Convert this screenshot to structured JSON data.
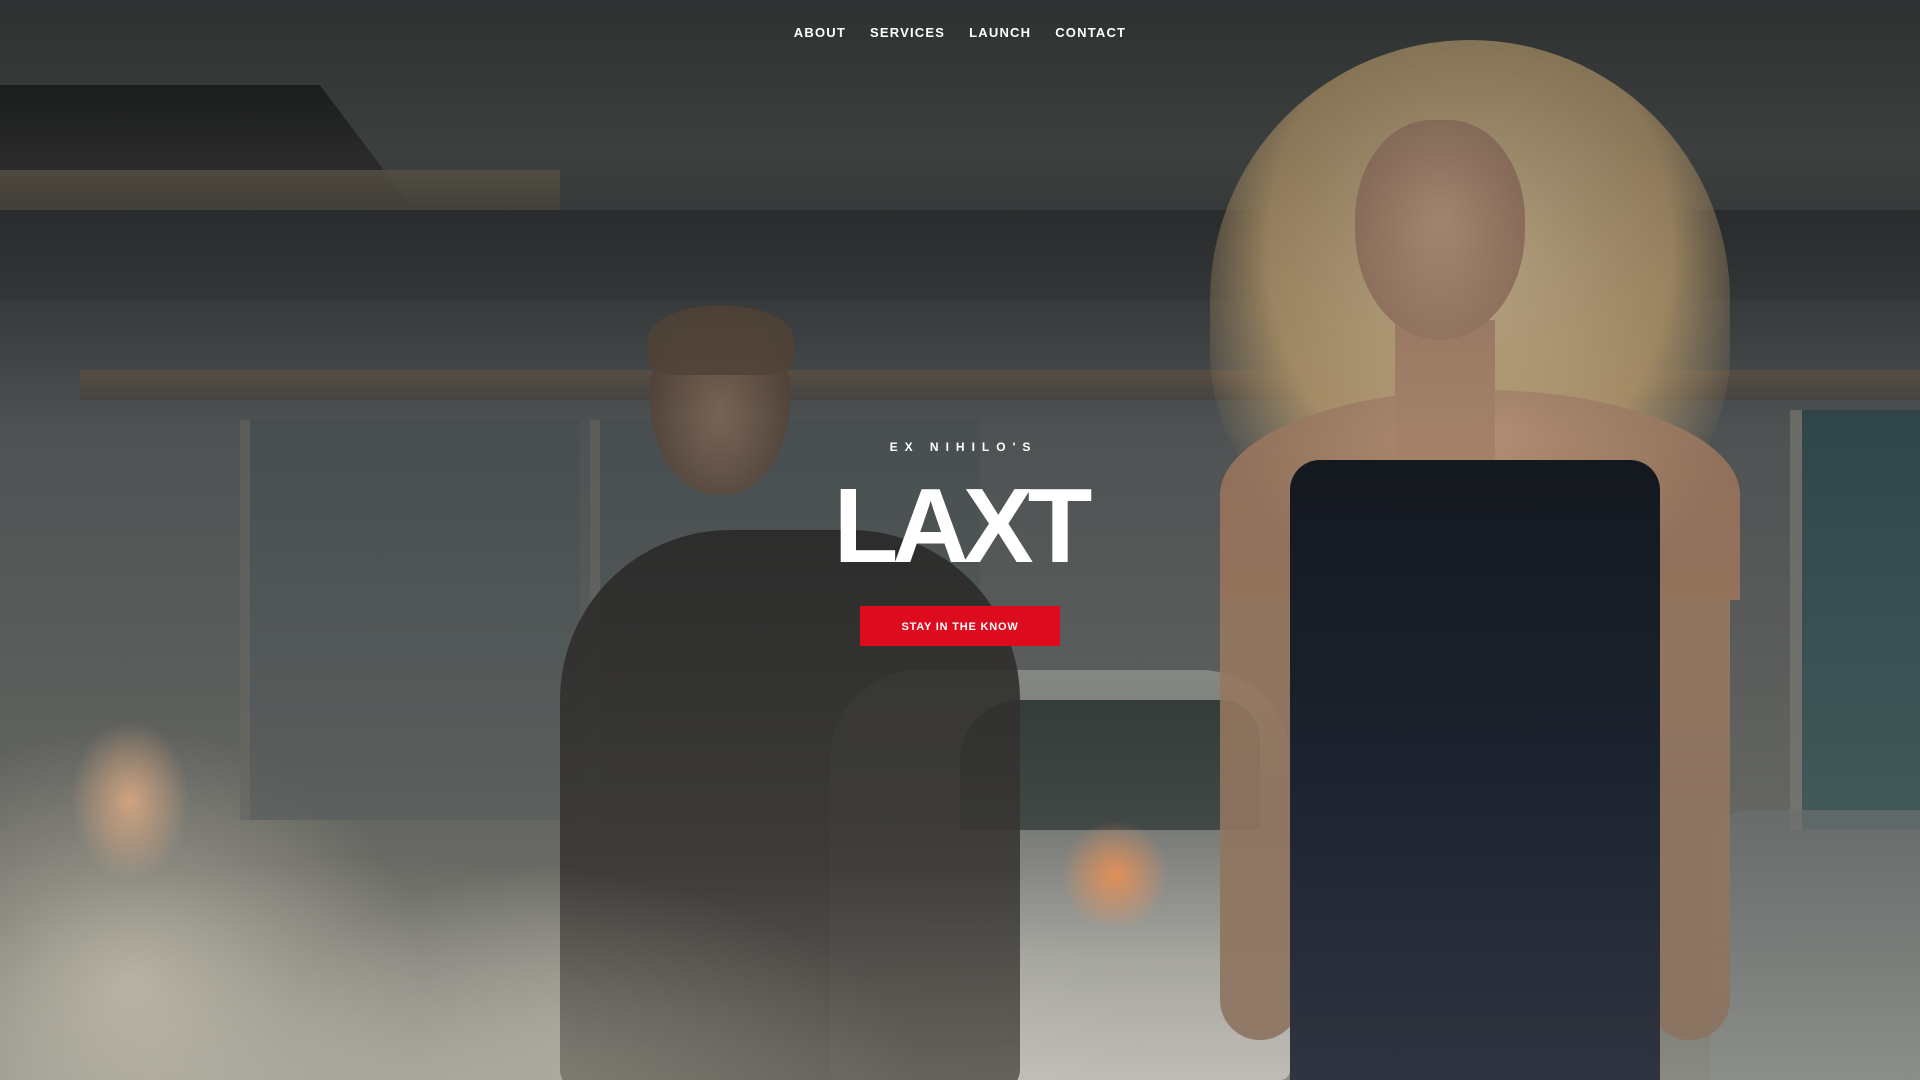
{
  "nav": {
    "items": [
      {
        "label": "ABOUT"
      },
      {
        "label": "SERVICES"
      },
      {
        "label": "LAUNCH"
      },
      {
        "label": "CONTACT"
      }
    ]
  },
  "hero": {
    "eyebrow": "EX NIHILO'S",
    "title": "LAXT",
    "cta_label": "STAY IN THE KNOW",
    "accent_color": "#dc0b1e",
    "background_image": "photo-couple-car-parking"
  }
}
